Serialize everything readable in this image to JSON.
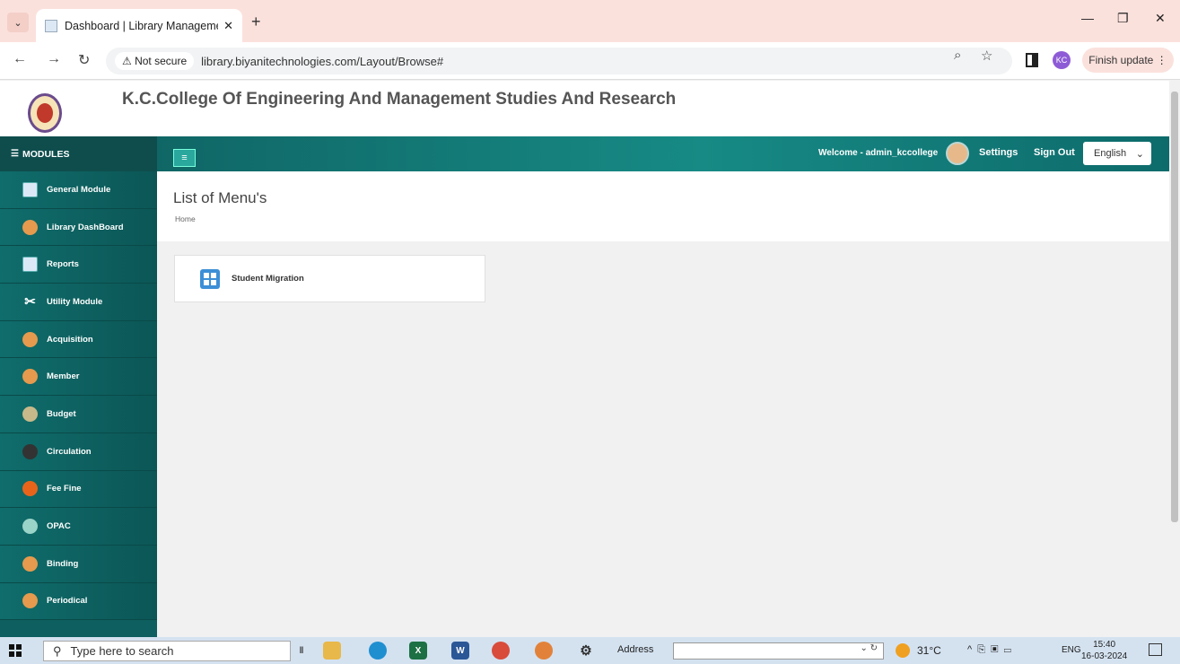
{
  "browser": {
    "tab_title": "Dashboard | Library Manageme",
    "tab_close": "✕",
    "new_tab": "+",
    "minimize": "—",
    "restore": "❐",
    "close": "✕",
    "security_label": "⚠ Not secure",
    "url": "library.biyanitechnologies.com/Layout/Browse#",
    "profile_initials": "KC",
    "finish_update": "Finish update ⋮"
  },
  "site": {
    "college_name": "K.C.College Of Engineering And Management Studies And Research",
    "modules_label": "MODULES",
    "welcome": "Welcome - admin_kccollege",
    "settings": "Settings",
    "sign_out": "Sign Out",
    "language": "English"
  },
  "sidebar": {
    "items": [
      {
        "label": "General Module"
      },
      {
        "label": "Library DashBoard"
      },
      {
        "label": "Reports"
      },
      {
        "label": "Utility Module"
      },
      {
        "label": "Acquisition"
      },
      {
        "label": "Member"
      },
      {
        "label": "Budget"
      },
      {
        "label": "Circulation"
      },
      {
        "label": "Fee Fine"
      },
      {
        "label": "OPAC"
      },
      {
        "label": "Binding"
      },
      {
        "label": "Periodical"
      }
    ]
  },
  "main": {
    "title": "List of Menu's",
    "breadcrumb": "Home",
    "cards": [
      {
        "label": "Student Migration"
      }
    ]
  },
  "taskbar": {
    "search_placeholder": "Type here to search",
    "address_label": "Address",
    "temperature": "31°C",
    "language": "ENG",
    "time": "15:40",
    "date": "16-03-2024"
  },
  "colors": {
    "tabstrip": "#fbe1dc",
    "topnav": "#178a85",
    "sidebar": "#0e5f5f"
  }
}
